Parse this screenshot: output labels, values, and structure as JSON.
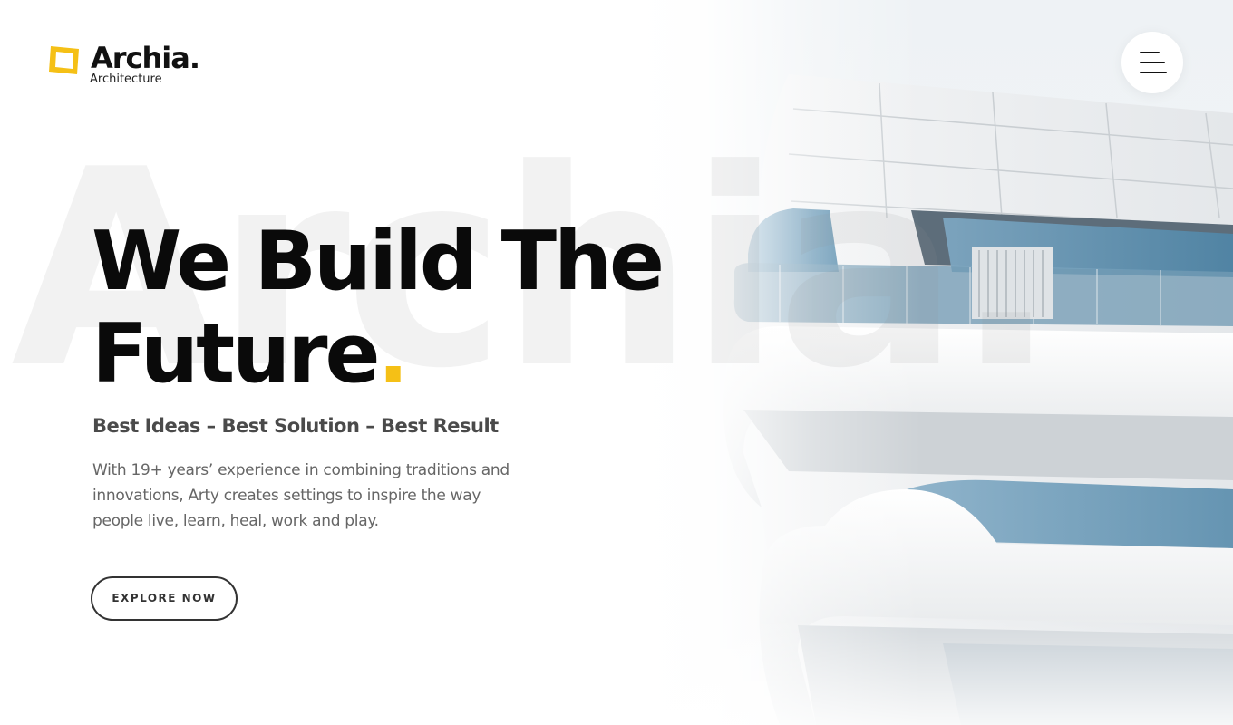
{
  "brand": {
    "name": "Archia.",
    "tagline": "Architecture",
    "watermark": "Archia.",
    "accent_color": "#f5c016",
    "logo_icon": "tilted-yellow-square-icon"
  },
  "header": {
    "menu_icon": "hamburger-menu-icon"
  },
  "hero": {
    "title_line1": "We Build The",
    "title_line2": "Future",
    "title_dot": ".",
    "subtitle": "Best Ideas – Best Solution – Best Result",
    "description": "With 19+ years’ experience in combining traditions and innovations, Arty creates settings to inspire the way people live, learn, heal, work and play.",
    "cta_label": "EXPLORE NOW",
    "background_image": "modern-white-building-photo"
  }
}
